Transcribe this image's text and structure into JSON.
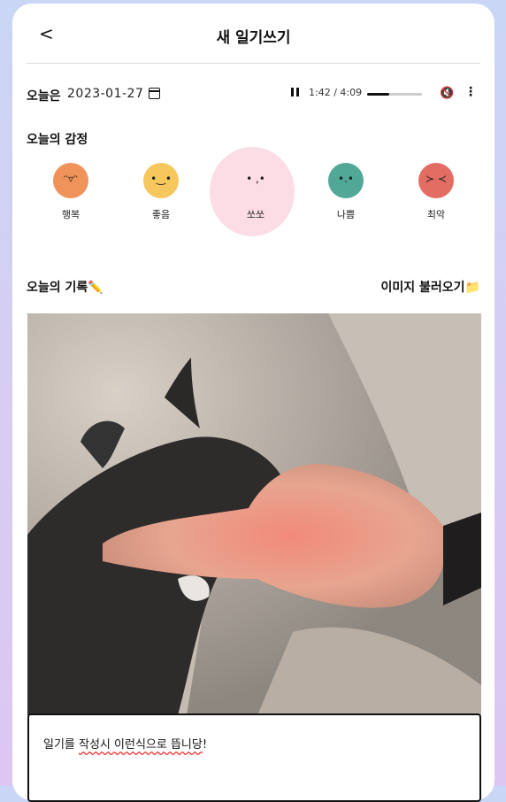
{
  "header": {
    "back_icon": "chevron-left-icon",
    "title": "새 일기쓰기"
  },
  "date_row": {
    "label": "오늘은",
    "date_value": "2023-01-27",
    "calendar_icon": "calendar-icon"
  },
  "player": {
    "play_state_icon": "pause-icon",
    "time": "1:42 / 4:09",
    "progress": 0.41,
    "mute_icon": "volume-mute-icon",
    "more_icon": "more-vertical-icon"
  },
  "emotion_section": {
    "title": "오늘의 감정",
    "emotions": [
      {
        "label": "행복",
        "color": "#f0935a",
        "face": "ᵔ▿ᵔ"
      },
      {
        "label": "좋음",
        "color": "#f6c75d",
        "face": "•‿•"
      },
      {
        "label": "쏘쏘",
        "color": "#fcdde5",
        "face": "• ,•",
        "selected": true
      },
      {
        "label": "나쁨",
        "color": "#52a897",
        "face": "•.•"
      },
      {
        "label": "최악",
        "color": "#e36c63",
        "face": "≻ ≺"
      }
    ]
  },
  "record_section": {
    "title": "오늘의 기록✏️",
    "import_image_button": "이미지 불러오기📁"
  },
  "photo": {
    "alt": "cat-photo"
  },
  "diary": {
    "text_part1": "일기를 ",
    "text_part2": "작성시 이런식으로 뜹니당",
    "text_part3": "!"
  }
}
